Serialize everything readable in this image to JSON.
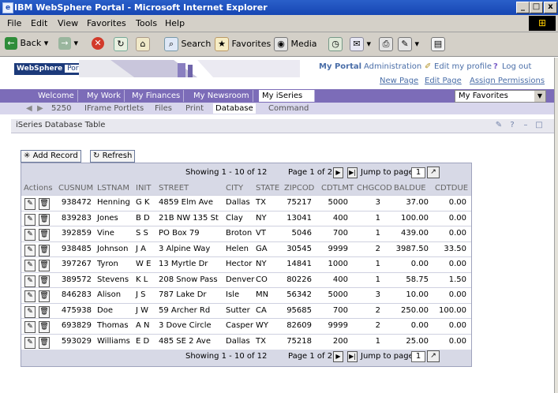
{
  "window": {
    "title": "IBM WebSphere Portal - Microsoft Internet Explorer",
    "min_label": "_",
    "max_label": "□",
    "close_label": "x"
  },
  "menu": [
    "File",
    "Edit",
    "View",
    "Favorites",
    "Tools",
    "Help"
  ],
  "toolbar": {
    "back_label": "Back",
    "search_label": "Search",
    "favorites_label": "Favorites",
    "media_label": "Media"
  },
  "portal": {
    "logo_main": "WebSphere",
    "logo_sub": "Portal",
    "top_links": {
      "my_portal": "My Portal",
      "administration": "Administration",
      "edit_profile": "Edit my profile",
      "help": "?",
      "logout": "Log out"
    },
    "sub_links": {
      "new_page": "New Page",
      "edit_page": "Edit Page",
      "assign_permissions": "Assign Permissions"
    }
  },
  "nav_tabs": [
    "Welcome",
    "My Work",
    "My Finances",
    "My Newsroom",
    "My iSeries"
  ],
  "nav_active": "My iSeries",
  "favorites_select": "My Favorites",
  "sub_tabs": [
    "5250",
    "IFrame Portlets",
    "Files",
    "Print",
    "Database",
    "Command"
  ],
  "sub_active": "Database",
  "portlet": {
    "title": "iSeries Database Table",
    "add_record": "Add Record",
    "refresh": "Refresh"
  },
  "pager": {
    "showing": "Showing 1 - 10 of 12",
    "page": "Page 1 of 2",
    "jump_label": "Jump to page:",
    "jump_value": "1"
  },
  "columns": [
    "Actions",
    "CUSNUM",
    "LSTNAM",
    "INIT",
    "STREET",
    "CITY",
    "STATE",
    "ZIPCOD",
    "CDTLMT",
    "CHGCOD",
    "BALDUE",
    "CDTDUE"
  ],
  "rows": [
    [
      "938472",
      "Henning",
      "G K",
      "4859 Elm Ave",
      "Dallas",
      "TX",
      "75217",
      "5000",
      "3",
      "37.00",
      "0.00"
    ],
    [
      "839283",
      "Jones",
      "B D",
      "21B NW 135 St",
      "Clay",
      "NY",
      "13041",
      "400",
      "1",
      "100.00",
      "0.00"
    ],
    [
      "392859",
      "Vine",
      "S S",
      "PO Box 79",
      "Broton",
      "VT",
      "5046",
      "700",
      "1",
      "439.00",
      "0.00"
    ],
    [
      "938485",
      "Johnson",
      "J A",
      "3 Alpine Way",
      "Helen",
      "GA",
      "30545",
      "9999",
      "2",
      "3987.50",
      "33.50"
    ],
    [
      "397267",
      "Tyron",
      "W E",
      "13 Myrtle Dr",
      "Hector",
      "NY",
      "14841",
      "1000",
      "1",
      "0.00",
      "0.00"
    ],
    [
      "389572",
      "Stevens",
      "K L",
      "208 Snow Pass",
      "Denver",
      "CO",
      "80226",
      "400",
      "1",
      "58.75",
      "1.50"
    ],
    [
      "846283",
      "Alison",
      "J S",
      "787 Lake Dr",
      "Isle",
      "MN",
      "56342",
      "5000",
      "3",
      "10.00",
      "0.00"
    ],
    [
      "475938",
      "Doe",
      "J W",
      "59 Archer Rd",
      "Sutter",
      "CA",
      "95685",
      "700",
      "2",
      "250.00",
      "100.00"
    ],
    [
      "693829",
      "Thomas",
      "A N",
      "3 Dove Circle",
      "Casper",
      "WY",
      "82609",
      "9999",
      "2",
      "0.00",
      "0.00"
    ],
    [
      "593029",
      "Williams",
      "E D",
      "485 SE 2 Ave",
      "Dallas",
      "TX",
      "75218",
      "200",
      "1",
      "25.00",
      "0.00"
    ]
  ],
  "colors": {
    "nav_primary": "#7c6cb8",
    "nav_secondary": "#d8d6ec",
    "table_bg": "#d7d9e6",
    "link": "#4a6ea8"
  }
}
